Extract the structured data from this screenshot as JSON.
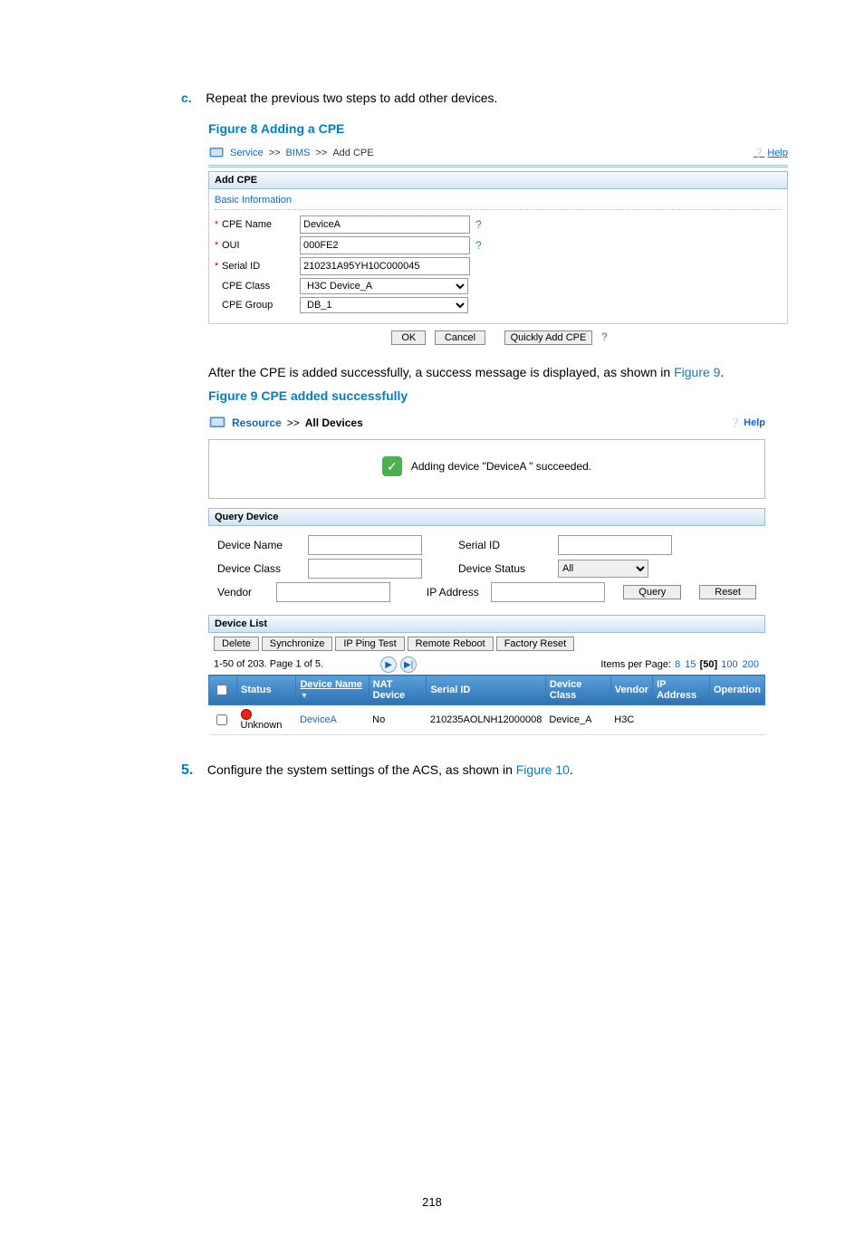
{
  "page_number": "218",
  "step_c": {
    "letter": "c.",
    "text": "Repeat the previous two steps to add other devices."
  },
  "figure8": {
    "title": "Figure 8 Adding a CPE",
    "breadcrumb": {
      "a": "Service",
      "b": "BIMS",
      "c": "Add CPE"
    },
    "help": "Help",
    "panel_title": "Add CPE",
    "sub_title": "Basic Information",
    "fields": {
      "cpe_name": {
        "label": "CPE Name",
        "value": "DeviceA",
        "required": true,
        "help": true
      },
      "oui": {
        "label": "OUI",
        "value": "000FE2",
        "required": true,
        "help": true
      },
      "serial_id": {
        "label": "Serial ID",
        "value": "210231A95YH10C000045",
        "required": true,
        "help": false
      },
      "cpe_class": {
        "label": "CPE Class",
        "value": "H3C Device_A"
      },
      "cpe_group": {
        "label": "CPE Group",
        "value": "DB_1"
      }
    },
    "buttons": {
      "ok": "OK",
      "cancel": "Cancel",
      "quick": "Quickly Add CPE"
    }
  },
  "after_text": {
    "pre": "After the CPE is added successfully, a success message is displayed, as shown in ",
    "link": "Figure 9",
    "post": "."
  },
  "figure9": {
    "title": "Figure 9 CPE added successfully",
    "breadcrumb": {
      "a": "Resource",
      "b": "All Devices"
    },
    "help": "Help",
    "success_msg": "Adding device \"DeviceA \" succeeded.",
    "query": {
      "title": "Query Device",
      "labels": {
        "device_name": "Device Name",
        "serial_id": "Serial ID",
        "device_class": "Device Class",
        "device_status": "Device Status",
        "vendor": "Vendor",
        "ip_address": "IP Address"
      },
      "status_value": "All",
      "buttons": {
        "query": "Query",
        "reset": "Reset"
      }
    },
    "list": {
      "title": "Device List",
      "toolbar": {
        "delete": "Delete",
        "sync": "Synchronize",
        "ping": "IP Ping Test",
        "reboot": "Remote Reboot",
        "factory": "Factory Reset"
      },
      "pager_left": "1-50 of 203. Page 1 of 5.",
      "ipp_label": "Items per Page:",
      "ipp": {
        "a": "8",
        "b": "15",
        "cur": "[50]",
        "c": "100",
        "d": "200"
      },
      "columns": {
        "status": "Status",
        "device_name": "Device Name",
        "nat": "NAT Device",
        "serial": "Serial ID",
        "class": "Device Class",
        "vendor": "Vendor",
        "ip": "IP Address",
        "op": "Operation"
      },
      "row": {
        "status": "Unknown",
        "name": "DeviceA",
        "nat": "No",
        "serial": "210235AOLNH12000008",
        "class": "Device_A",
        "vendor": "H3C",
        "ip": "",
        "op": ""
      }
    }
  },
  "step5": {
    "num": "5.",
    "pre": "Configure the system settings of the ACS, as shown in ",
    "link": "Figure 10",
    "post": "."
  }
}
